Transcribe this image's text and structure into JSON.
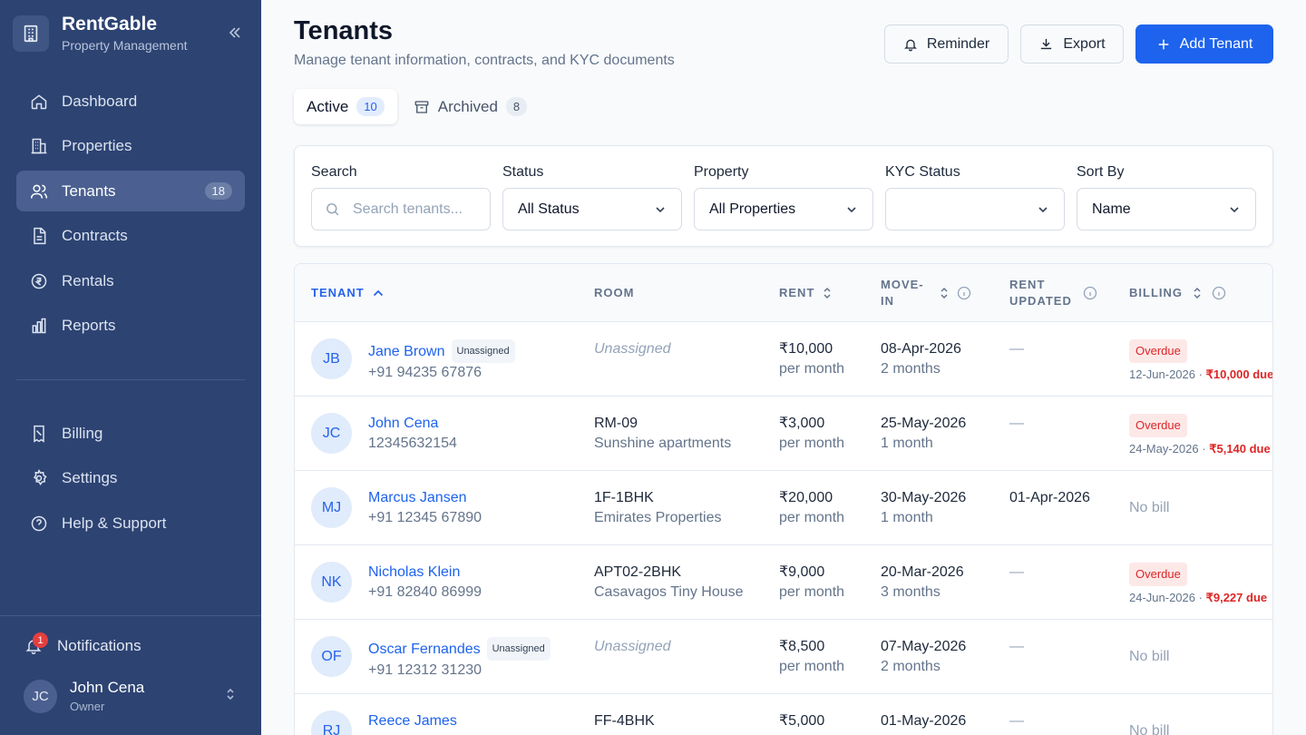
{
  "brand": {
    "name": "RentGable",
    "subtitle": "Property Management"
  },
  "sidebar": {
    "items": [
      {
        "label": "Dashboard",
        "icon": "home-icon"
      },
      {
        "label": "Properties",
        "icon": "building-icon"
      },
      {
        "label": "Tenants",
        "icon": "users-icon",
        "badge": "18",
        "active": true
      },
      {
        "label": "Contracts",
        "icon": "file-icon"
      },
      {
        "label": "Rentals",
        "icon": "rupee-icon"
      },
      {
        "label": "Reports",
        "icon": "bar-chart-icon"
      }
    ],
    "secondary": [
      {
        "label": "Billing",
        "icon": "receipt-icon"
      },
      {
        "label": "Settings",
        "icon": "gear-icon"
      },
      {
        "label": "Help & Support",
        "icon": "help-icon"
      }
    ],
    "notifications": {
      "label": "Notifications",
      "count": "1"
    },
    "user": {
      "initials": "JC",
      "name": "John Cena",
      "role": "Owner"
    }
  },
  "header": {
    "title": "Tenants",
    "subtitle": "Manage tenant information, contracts, and KYC documents",
    "reminder_label": "Reminder",
    "export_label": "Export",
    "add_label": "Add Tenant"
  },
  "tabs": [
    {
      "label": "Active",
      "count": "10",
      "active": true
    },
    {
      "label": "Archived",
      "count": "8",
      "active": false
    }
  ],
  "filters": {
    "search": {
      "label": "Search",
      "placeholder": "Search tenants..."
    },
    "status": {
      "label": "Status",
      "value": "All Status"
    },
    "property": {
      "label": "Property",
      "value": "All Properties"
    },
    "kyc": {
      "label": "KYC Status",
      "value": ""
    },
    "sort": {
      "label": "Sort By",
      "value": "Name"
    }
  },
  "table": {
    "columns": {
      "tenant": "TENANT",
      "room": "ROOM",
      "rent": "RENT",
      "movein_1": "MOVE-",
      "movein_2": "IN",
      "rentupd_1": "RENT",
      "rentupd_2": "UPDATED",
      "billing": "BILLING"
    },
    "rows": [
      {
        "initials": "JB",
        "name": "Jane Brown",
        "tag": "Unassigned",
        "phone": "+91 94235 67876",
        "room": "Unassigned",
        "room_sub": "",
        "rent": "₹10,000",
        "rent_period": "per month",
        "movein": "08-Apr-2026",
        "duration": "2 months",
        "rent_updated": "—",
        "billing_status": "Overdue",
        "billing_date": "12-Jun-2026",
        "billing_sep": "·",
        "billing_amount": "₹10,000 due"
      },
      {
        "initials": "JC",
        "name": "John Cena",
        "tag": "",
        "phone": "12345632154",
        "room": "RM-09",
        "room_sub": "Sunshine apartments",
        "rent": "₹3,000",
        "rent_period": "per month",
        "movein": "25-May-2026",
        "duration": "1 month",
        "rent_updated": "—",
        "billing_status": "Overdue",
        "billing_date": "24-May-2026",
        "billing_sep": "·",
        "billing_amount": "₹5,140 due"
      },
      {
        "initials": "MJ",
        "name": "Marcus Jansen",
        "tag": "",
        "phone": "+91 12345 67890",
        "room": "1F-1BHK",
        "room_sub": "Emirates Properties",
        "rent": "₹20,000",
        "rent_period": "per month",
        "movein": "30-May-2026",
        "duration": "1 month",
        "rent_updated": "01-Apr-2026",
        "billing_status": "No bill"
      },
      {
        "initials": "NK",
        "name": "Nicholas Klein",
        "tag": "",
        "phone": "+91 82840 86999",
        "room": "APT02-2BHK",
        "room_sub": "Casavagos Tiny House",
        "rent": "₹9,000",
        "rent_period": "per month",
        "movein": "20-Mar-2026",
        "duration": "3 months",
        "rent_updated": "—",
        "billing_status": "Overdue",
        "billing_date": "24-Jun-2026",
        "billing_sep": "·",
        "billing_amount": "₹9,227 due"
      },
      {
        "initials": "OF",
        "name": "Oscar Fernandes",
        "tag": "Unassigned",
        "phone": "+91 12312 31230",
        "room": "Unassigned",
        "room_sub": "",
        "rent": "₹8,500",
        "rent_period": "per month",
        "movein": "07-May-2026",
        "duration": "2 months",
        "rent_updated": "—",
        "billing_status": "No bill"
      },
      {
        "initials": "RJ",
        "name": "Reece James",
        "tag": "",
        "phone": "",
        "room": "FF-4BHK",
        "room_sub": "",
        "rent": "₹5,000",
        "rent_period": "",
        "movein": "01-May-2026",
        "duration": "",
        "rent_updated": "—",
        "billing_status": "No bill"
      }
    ]
  },
  "colors": {
    "sidebar": "#2d4372",
    "accent": "#1d63ed",
    "danger": "#dc2626"
  }
}
